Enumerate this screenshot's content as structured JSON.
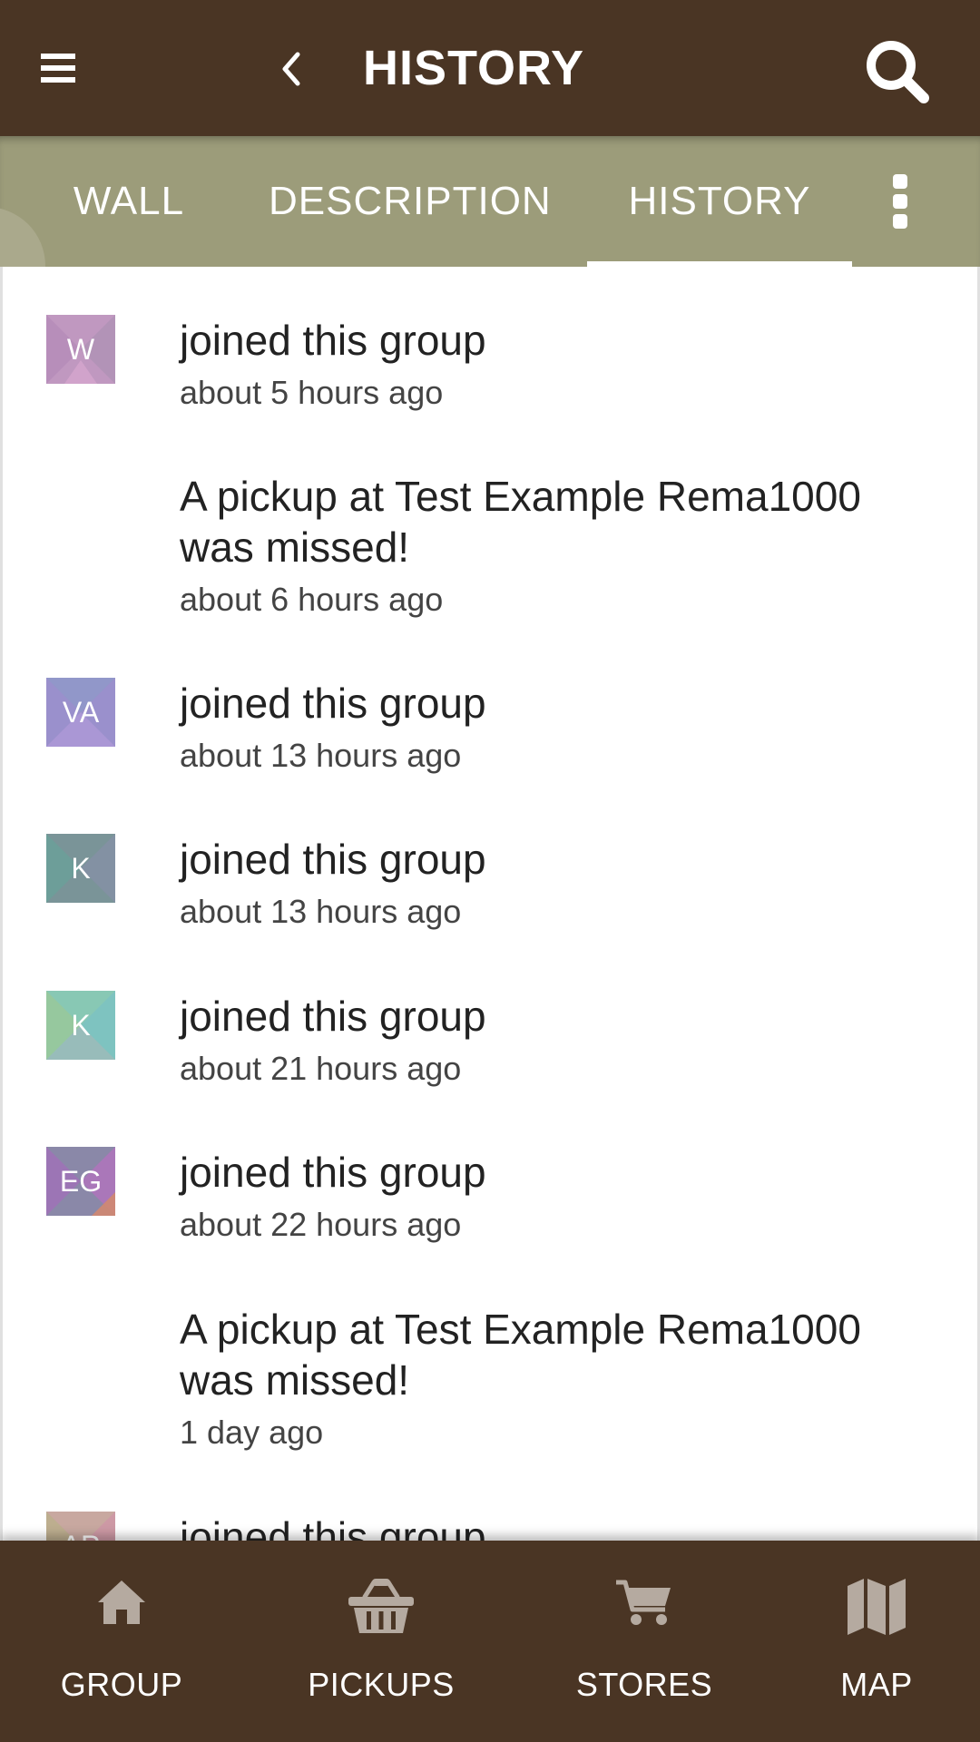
{
  "header": {
    "title": "HISTORY",
    "menu_icon": "hamburger-menu-icon",
    "back_icon": "chevron-left-icon",
    "search_icon": "search-icon",
    "background": "#4a3524"
  },
  "tabs": {
    "items": [
      {
        "label": "WALL"
      },
      {
        "label": "DESCRIPTION"
      },
      {
        "label": "HISTORY",
        "active": true
      }
    ],
    "more_icon": "more-vertical-icon",
    "background": "#9c9c7a"
  },
  "history": [
    {
      "avatar": "W",
      "avatar_color": "#c098c0",
      "title": "joined this group",
      "time": "about 5 hours ago"
    },
    {
      "avatar": "",
      "title": "A pickup at Test Example Rema1000 was missed!",
      "time": "about 6 hours ago"
    },
    {
      "avatar": "VA",
      "avatar_color": "#9a90cc",
      "title": "joined this group",
      "time": "about 13 hours ago"
    },
    {
      "avatar": "K",
      "avatar_color": "#7a9498",
      "title": "joined this group",
      "time": "about 13 hours ago"
    },
    {
      "avatar": "K",
      "avatar_color": "#88c8b4",
      "title": "joined this group",
      "time": "about 21 hours ago"
    },
    {
      "avatar": "EG",
      "avatar_color": "#8a88a8",
      "title": "joined this group",
      "time": "about 22 hours ago"
    },
    {
      "avatar": "",
      "title": "A pickup at Test Example Rema1000 was missed!",
      "time": "1 day ago"
    },
    {
      "avatar": "AP",
      "avatar_color": "#c8a8a0",
      "title": "joined this group",
      "time": ""
    }
  ],
  "bottom_nav": [
    {
      "label": "GROUP",
      "icon": "home-icon"
    },
    {
      "label": "PICKUPS",
      "icon": "basket-icon"
    },
    {
      "label": "STORES",
      "icon": "shopping-cart-icon"
    },
    {
      "label": "MAP",
      "icon": "map-icon"
    }
  ]
}
